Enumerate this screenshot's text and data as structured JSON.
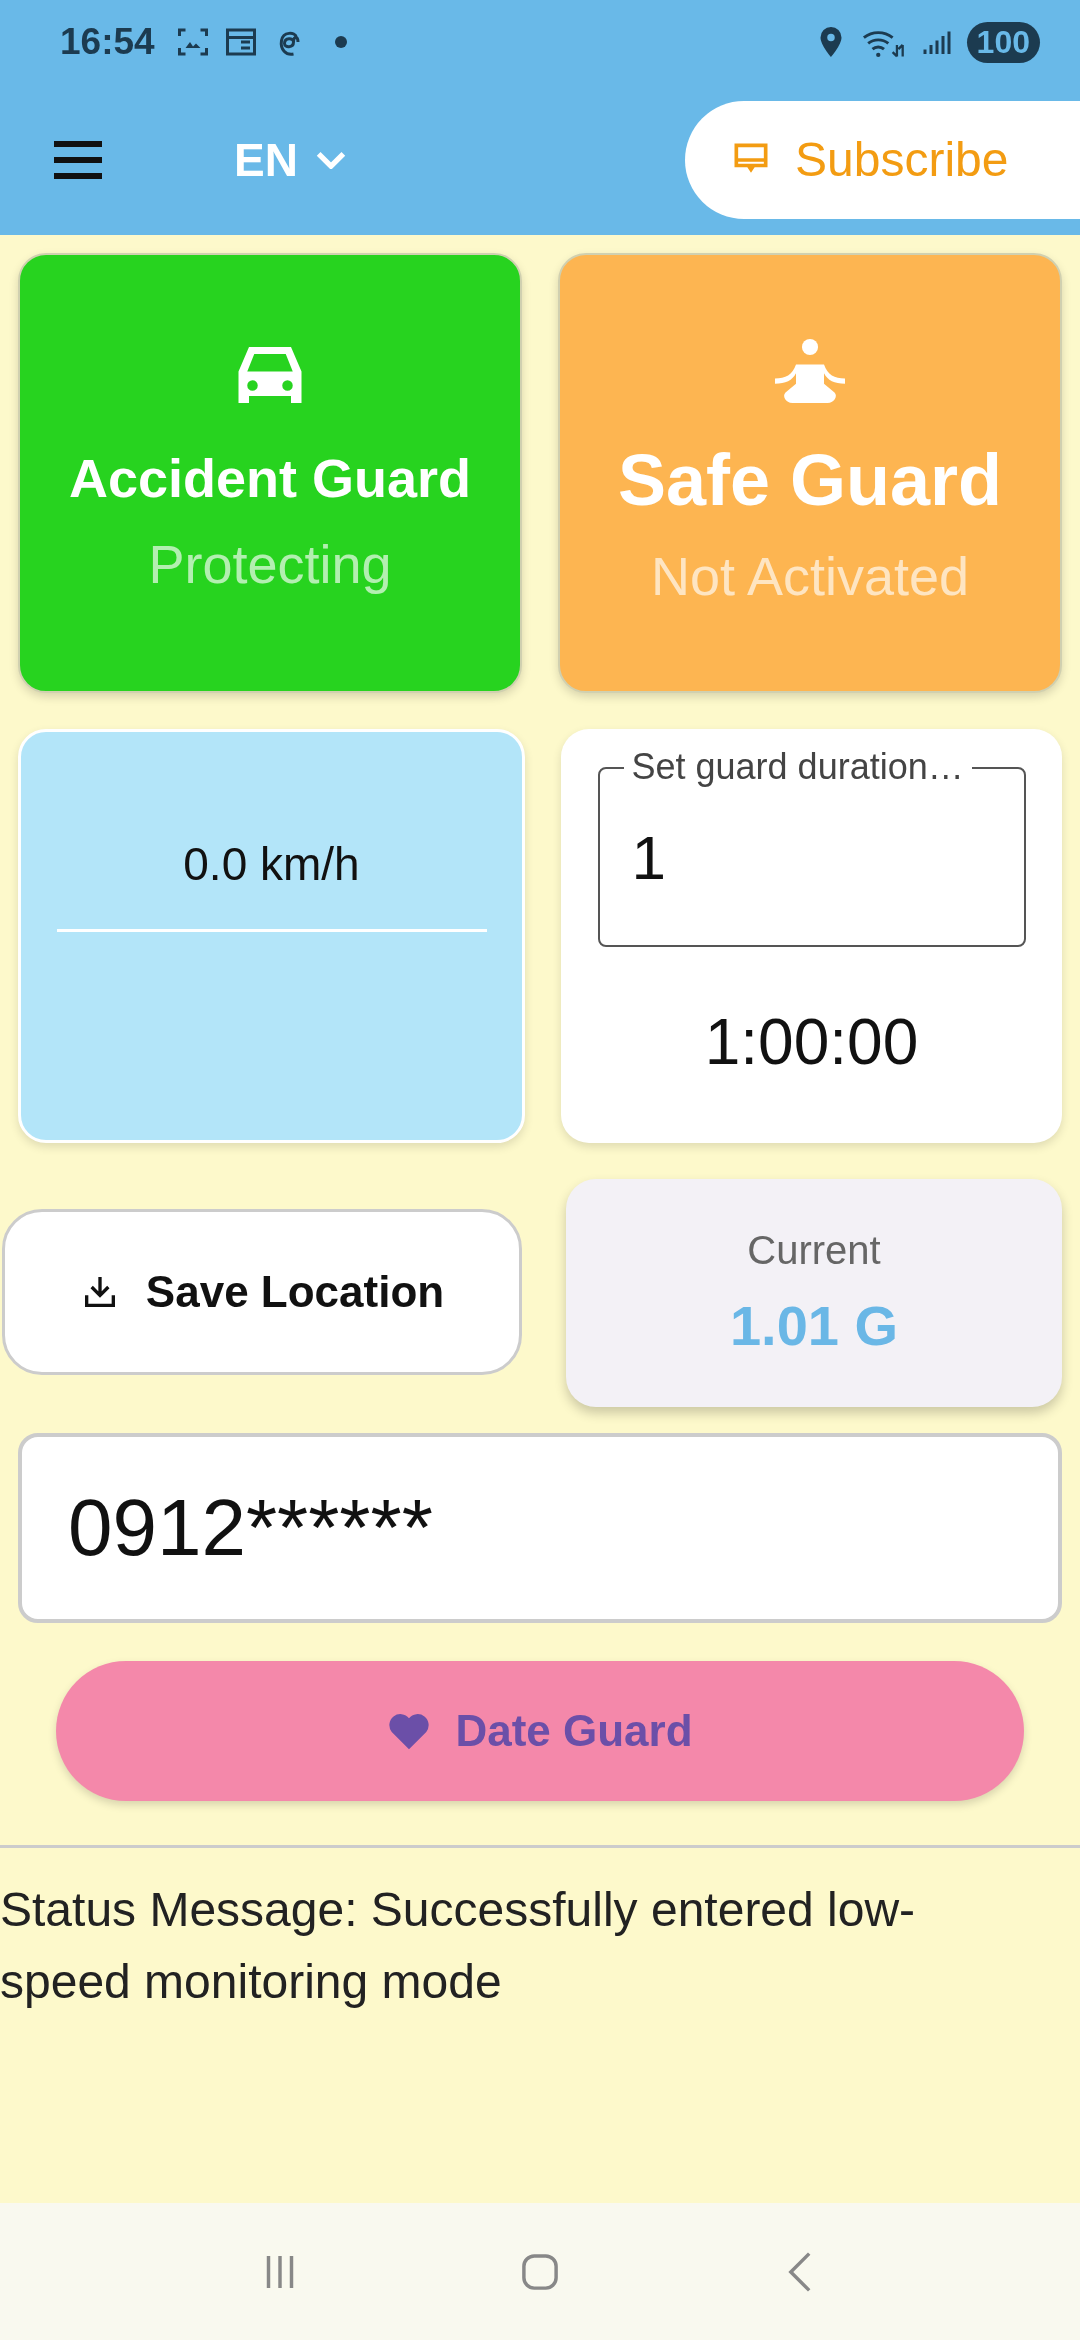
{
  "status_bar": {
    "time": "16:54",
    "battery": "100"
  },
  "app_bar": {
    "language": "EN",
    "subscribe_label": "Subscribe"
  },
  "guard_cards": [
    {
      "kind": "car",
      "title": "Accident Guard",
      "status": "Protecting",
      "color": "#27d31f",
      "active": true
    },
    {
      "kind": "meditation",
      "title": "Safe Guard",
      "status": "Not Activated",
      "color": "#fdb551",
      "active": false
    }
  ],
  "speed": {
    "reading": "0.0 km/h"
  },
  "duration": {
    "label": "Set guard duration…",
    "value": "1",
    "countdown": "1:00:00"
  },
  "save_location": {
    "label": "Save Location"
  },
  "g_force": {
    "label": "Current",
    "value": "1.01 G"
  },
  "phone": {
    "value": "0912******"
  },
  "date_guard": {
    "label": "Date Guard"
  },
  "status_message": "Status Message: Successfully entered low-speed monitoring mode"
}
